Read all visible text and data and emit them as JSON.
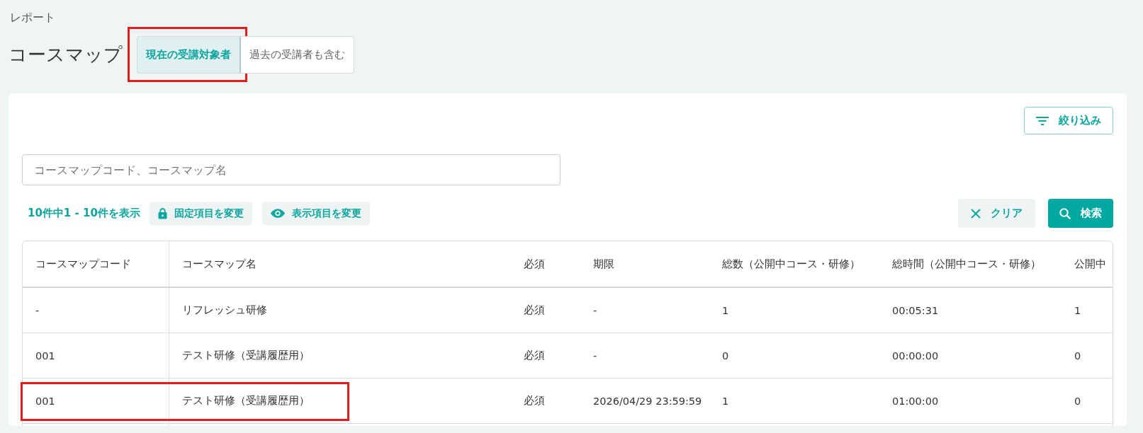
{
  "breadcrumb": "レポート",
  "title": "コースマップ",
  "tabs": [
    {
      "label": "現在の受講対象者",
      "selected": true,
      "highlighted": true
    },
    {
      "label": "過去の受講者も含む",
      "selected": false,
      "highlighted": false
    }
  ],
  "filter_button": {
    "label": "絞り込み"
  },
  "search": {
    "placeholder": "コースマップコード、コースマップ名"
  },
  "result_count": "10件中1 - 10件を表示",
  "toolbar_buttons": [
    {
      "kind": "lock",
      "label": "固定項目を変更"
    },
    {
      "kind": "eye",
      "label": "表示項目を変更"
    }
  ],
  "actions": [
    {
      "kind": "clear",
      "label": "クリア"
    },
    {
      "kind": "search",
      "label": "検索"
    }
  ],
  "table": {
    "columns": [
      "コースマップコード",
      "コースマップ名",
      "必須",
      "期限",
      "総数（公開中コース・研修）",
      "総時間（公開中コース・研修）",
      "公開中"
    ],
    "rows": [
      {
        "cells": [
          "-",
          "リフレッシュ研修",
          "必須",
          "-",
          "1",
          "00:05:31",
          "1"
        ],
        "highlighted": false
      },
      {
        "cells": [
          "001",
          "テスト研修（受講履歴用）",
          "必須",
          "-",
          "0",
          "00:00:00",
          "0"
        ],
        "highlighted": false
      },
      {
        "cells": [
          "001",
          "テスト研修（受講履歴用）",
          "必須",
          "2026/04/29 23:59:59",
          "1",
          "01:00:00",
          "0"
        ],
        "highlighted": true
      }
    ]
  }
}
